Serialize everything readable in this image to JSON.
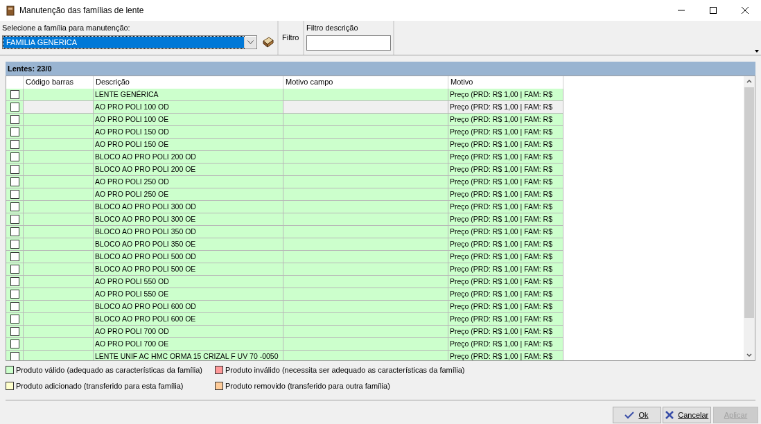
{
  "window": {
    "title": "Manutenção das famílias de lente"
  },
  "family_select": {
    "label": "Selecione a família para manutenção:",
    "value": "FAMILIA GENERICA"
  },
  "filter": {
    "label": "Filtro",
    "field_label": "Filtro descrição"
  },
  "grid": {
    "title": "Lentes: 23/0",
    "columns": [
      "Código barras",
      "Descrição",
      "Motivo campo",
      "Motivo"
    ],
    "rows": [
      {
        "checked": false,
        "focused": false,
        "color": "#ccffcc",
        "description": "LENTE GENÉRICA",
        "motivo": "Preço (PRD: R$ 1,00 | FAM: R$"
      },
      {
        "checked": false,
        "focused": true,
        "color": "#ccffcc",
        "description": "AO PRO POLI 100 OD",
        "motivo": "Preço (PRD: R$ 1,00 | FAM: R$"
      },
      {
        "checked": false,
        "focused": false,
        "color": "#ccffcc",
        "description": "AO PRO POLI 100 OE",
        "motivo": "Preço (PRD: R$ 1,00 | FAM: R$"
      },
      {
        "checked": false,
        "focused": false,
        "color": "#ccffcc",
        "description": "AO PRO POLI 150 OD",
        "motivo": "Preço (PRD: R$ 1,00 | FAM: R$"
      },
      {
        "checked": false,
        "focused": false,
        "color": "#ccffcc",
        "description": "AO PRO POLI 150 OE",
        "motivo": "Preço (PRD: R$ 1,00 | FAM: R$"
      },
      {
        "checked": false,
        "focused": false,
        "color": "#ccffcc",
        "description": "BLOCO AO PRO POLI 200 OD",
        "motivo": "Preço (PRD: R$ 1,00 | FAM: R$"
      },
      {
        "checked": false,
        "focused": false,
        "color": "#ccffcc",
        "description": "BLOCO AO PRO POLI 200 OE",
        "motivo": "Preço (PRD: R$ 1,00 | FAM: R$"
      },
      {
        "checked": false,
        "focused": false,
        "color": "#ccffcc",
        "description": "AO PRO POLI 250 OD",
        "motivo": "Preço (PRD: R$ 1,00 | FAM: R$"
      },
      {
        "checked": false,
        "focused": false,
        "color": "#ccffcc",
        "description": "AO PRO POLI 250 OE",
        "motivo": "Preço (PRD: R$ 1,00 | FAM: R$"
      },
      {
        "checked": false,
        "focused": false,
        "color": "#ccffcc",
        "description": "BLOCO AO PRO POLI 300 OD",
        "motivo": "Preço (PRD: R$ 1,00 | FAM: R$"
      },
      {
        "checked": false,
        "focused": false,
        "color": "#ccffcc",
        "description": "BLOCO AO PRO POLI 300 OE",
        "motivo": "Preço (PRD: R$ 1,00 | FAM: R$"
      },
      {
        "checked": false,
        "focused": false,
        "color": "#ccffcc",
        "description": "BLOCO AO PRO POLI 350 OD",
        "motivo": "Preço (PRD: R$ 1,00 | FAM: R$"
      },
      {
        "checked": false,
        "focused": false,
        "color": "#ccffcc",
        "description": "BLOCO AO PRO POLI 350 OE",
        "motivo": "Preço (PRD: R$ 1,00 | FAM: R$"
      },
      {
        "checked": false,
        "focused": false,
        "color": "#ccffcc",
        "description": "BLOCO AO PRO POLI 500 OD",
        "motivo": "Preço (PRD: R$ 1,00 | FAM: R$"
      },
      {
        "checked": false,
        "focused": false,
        "color": "#ccffcc",
        "description": "BLOCO AO PRO POLI 500 OE",
        "motivo": "Preço (PRD: R$ 1,00 | FAM: R$"
      },
      {
        "checked": false,
        "focused": false,
        "color": "#ccffcc",
        "description": "AO PRO POLI 550 OD",
        "motivo": "Preço (PRD: R$ 1,00 | FAM: R$"
      },
      {
        "checked": false,
        "focused": false,
        "color": "#ccffcc",
        "description": "AO PRO POLI 550 OE",
        "motivo": "Preço (PRD: R$ 1,00 | FAM: R$"
      },
      {
        "checked": false,
        "focused": false,
        "color": "#ccffcc",
        "description": "BLOCO AO PRO POLI 600 OD",
        "motivo": "Preço (PRD: R$ 1,00 | FAM: R$"
      },
      {
        "checked": false,
        "focused": false,
        "color": "#ccffcc",
        "description": "BLOCO AO PRO POLI 600 OE",
        "motivo": "Preço (PRD: R$ 1,00 | FAM: R$"
      },
      {
        "checked": false,
        "focused": false,
        "color": "#ccffcc",
        "description": "AO PRO POLI 700 OD",
        "motivo": "Preço (PRD: R$ 1,00 | FAM: R$"
      },
      {
        "checked": false,
        "focused": false,
        "color": "#ccffcc",
        "description": "AO PRO POLI 700 OE",
        "motivo": "Preço (PRD: R$ 1,00 | FAM: R$"
      },
      {
        "checked": false,
        "focused": false,
        "color": "#ccffcc",
        "description": "LENTE UNIF AC HMC ORMA 15 CRIZAL F UV 70 -0050",
        "motivo": "Preço (PRD: R$ 1,00 | FAM: R$"
      }
    ]
  },
  "legend": [
    {
      "color": "#ccffcc",
      "label": "Produto válido (adequado as características da família)"
    },
    {
      "color": "#ff9999",
      "label": "Produto inválido (necessita ser adequado as características da família)"
    },
    {
      "color": "#ffffcc",
      "label": "Produto adicionado (transferido para esta família)"
    },
    {
      "color": "#ffcc99",
      "label": "Produto removido (transferido para outra família)"
    }
  ],
  "buttons": [
    {
      "kind": "ok",
      "label": "Ok",
      "disabled": false
    },
    {
      "kind": "cancel",
      "label": "Cancelar",
      "disabled": false
    },
    {
      "kind": "apply",
      "label": "Aplicar",
      "disabled": true
    }
  ]
}
